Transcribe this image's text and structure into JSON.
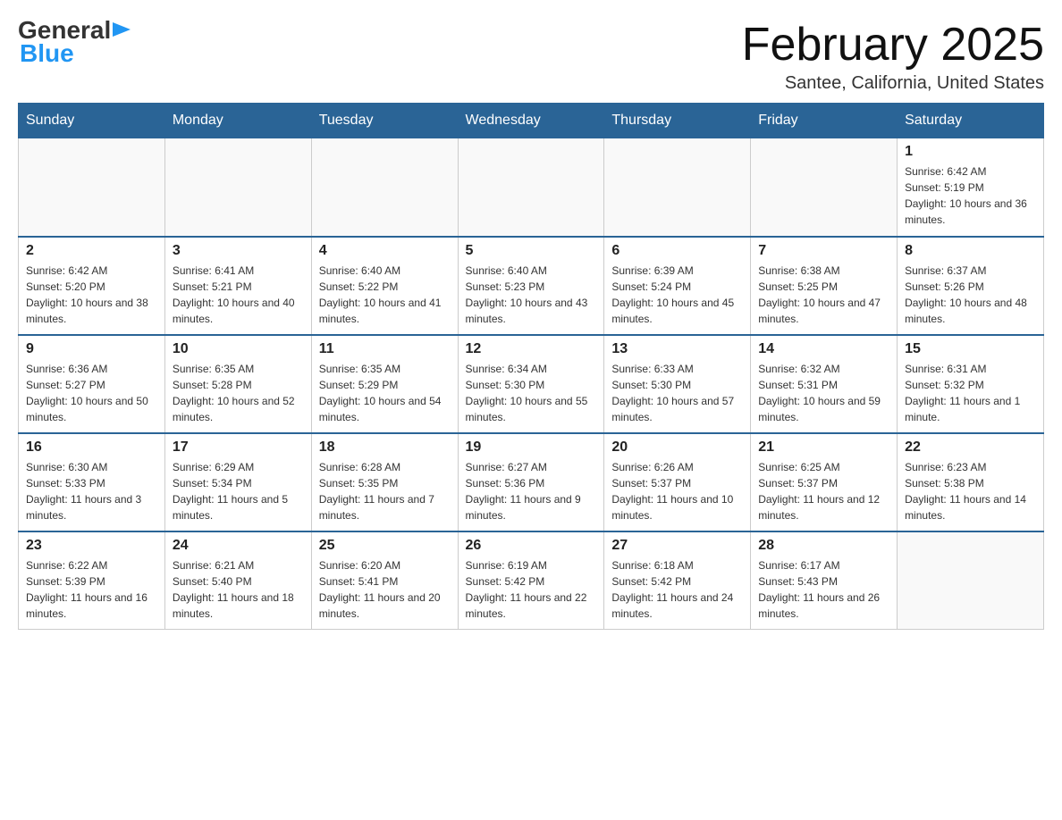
{
  "logo": {
    "line1": "General",
    "arrow": "▶",
    "line2": "Blue"
  },
  "title": "February 2025",
  "location": "Santee, California, United States",
  "days_of_week": [
    "Sunday",
    "Monday",
    "Tuesday",
    "Wednesday",
    "Thursday",
    "Friday",
    "Saturday"
  ],
  "weeks": [
    [
      {
        "day": "",
        "info": ""
      },
      {
        "day": "",
        "info": ""
      },
      {
        "day": "",
        "info": ""
      },
      {
        "day": "",
        "info": ""
      },
      {
        "day": "",
        "info": ""
      },
      {
        "day": "",
        "info": ""
      },
      {
        "day": "1",
        "info": "Sunrise: 6:42 AM\nSunset: 5:19 PM\nDaylight: 10 hours and 36 minutes."
      }
    ],
    [
      {
        "day": "2",
        "info": "Sunrise: 6:42 AM\nSunset: 5:20 PM\nDaylight: 10 hours and 38 minutes."
      },
      {
        "day": "3",
        "info": "Sunrise: 6:41 AM\nSunset: 5:21 PM\nDaylight: 10 hours and 40 minutes."
      },
      {
        "day": "4",
        "info": "Sunrise: 6:40 AM\nSunset: 5:22 PM\nDaylight: 10 hours and 41 minutes."
      },
      {
        "day": "5",
        "info": "Sunrise: 6:40 AM\nSunset: 5:23 PM\nDaylight: 10 hours and 43 minutes."
      },
      {
        "day": "6",
        "info": "Sunrise: 6:39 AM\nSunset: 5:24 PM\nDaylight: 10 hours and 45 minutes."
      },
      {
        "day": "7",
        "info": "Sunrise: 6:38 AM\nSunset: 5:25 PM\nDaylight: 10 hours and 47 minutes."
      },
      {
        "day": "8",
        "info": "Sunrise: 6:37 AM\nSunset: 5:26 PM\nDaylight: 10 hours and 48 minutes."
      }
    ],
    [
      {
        "day": "9",
        "info": "Sunrise: 6:36 AM\nSunset: 5:27 PM\nDaylight: 10 hours and 50 minutes."
      },
      {
        "day": "10",
        "info": "Sunrise: 6:35 AM\nSunset: 5:28 PM\nDaylight: 10 hours and 52 minutes."
      },
      {
        "day": "11",
        "info": "Sunrise: 6:35 AM\nSunset: 5:29 PM\nDaylight: 10 hours and 54 minutes."
      },
      {
        "day": "12",
        "info": "Sunrise: 6:34 AM\nSunset: 5:30 PM\nDaylight: 10 hours and 55 minutes."
      },
      {
        "day": "13",
        "info": "Sunrise: 6:33 AM\nSunset: 5:30 PM\nDaylight: 10 hours and 57 minutes."
      },
      {
        "day": "14",
        "info": "Sunrise: 6:32 AM\nSunset: 5:31 PM\nDaylight: 10 hours and 59 minutes."
      },
      {
        "day": "15",
        "info": "Sunrise: 6:31 AM\nSunset: 5:32 PM\nDaylight: 11 hours and 1 minute."
      }
    ],
    [
      {
        "day": "16",
        "info": "Sunrise: 6:30 AM\nSunset: 5:33 PM\nDaylight: 11 hours and 3 minutes."
      },
      {
        "day": "17",
        "info": "Sunrise: 6:29 AM\nSunset: 5:34 PM\nDaylight: 11 hours and 5 minutes."
      },
      {
        "day": "18",
        "info": "Sunrise: 6:28 AM\nSunset: 5:35 PM\nDaylight: 11 hours and 7 minutes."
      },
      {
        "day": "19",
        "info": "Sunrise: 6:27 AM\nSunset: 5:36 PM\nDaylight: 11 hours and 9 minutes."
      },
      {
        "day": "20",
        "info": "Sunrise: 6:26 AM\nSunset: 5:37 PM\nDaylight: 11 hours and 10 minutes."
      },
      {
        "day": "21",
        "info": "Sunrise: 6:25 AM\nSunset: 5:37 PM\nDaylight: 11 hours and 12 minutes."
      },
      {
        "day": "22",
        "info": "Sunrise: 6:23 AM\nSunset: 5:38 PM\nDaylight: 11 hours and 14 minutes."
      }
    ],
    [
      {
        "day": "23",
        "info": "Sunrise: 6:22 AM\nSunset: 5:39 PM\nDaylight: 11 hours and 16 minutes."
      },
      {
        "day": "24",
        "info": "Sunrise: 6:21 AM\nSunset: 5:40 PM\nDaylight: 11 hours and 18 minutes."
      },
      {
        "day": "25",
        "info": "Sunrise: 6:20 AM\nSunset: 5:41 PM\nDaylight: 11 hours and 20 minutes."
      },
      {
        "day": "26",
        "info": "Sunrise: 6:19 AM\nSunset: 5:42 PM\nDaylight: 11 hours and 22 minutes."
      },
      {
        "day": "27",
        "info": "Sunrise: 6:18 AM\nSunset: 5:42 PM\nDaylight: 11 hours and 24 minutes."
      },
      {
        "day": "28",
        "info": "Sunrise: 6:17 AM\nSunset: 5:43 PM\nDaylight: 11 hours and 26 minutes."
      },
      {
        "day": "",
        "info": ""
      }
    ]
  ]
}
